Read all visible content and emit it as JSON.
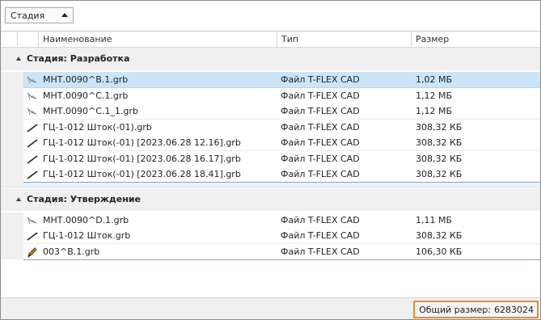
{
  "toolbar": {
    "group_by_label": "Стадия"
  },
  "columns": {
    "name": "Наименование",
    "type": "Тип",
    "size": "Размер"
  },
  "groups": [
    {
      "title": "Стадия: Разработка",
      "rows": [
        {
          "name": "МНТ.0090^В.1.grb",
          "type": "Файл T-FLEX CAD",
          "size": "1,02 МБ",
          "icon": "drawing-icon",
          "selected": true
        },
        {
          "name": "МНТ.0090^С.1.grb",
          "type": "Файл T-FLEX CAD",
          "size": "1,12 МБ",
          "icon": "drawing-icon"
        },
        {
          "name": "МНТ.0090^С.1_1.grb",
          "type": "Файл T-FLEX CAD",
          "size": "1,12 МБ",
          "icon": "drawing-icon"
        },
        {
          "name": "ГЦ-1-012 Шток(-01).grb",
          "type": "Файл T-FLEX CAD",
          "size": "308,32 КБ",
          "icon": "line-icon"
        },
        {
          "name": "ГЦ-1-012 Шток(-01) [2023.06.28 12.16].grb",
          "type": "Файл T-FLEX CAD",
          "size": "308,32 КБ",
          "icon": "line-icon"
        },
        {
          "name": "ГЦ-1-012 Шток(-01) [2023.06.28 16.17].grb",
          "type": "Файл T-FLEX CAD",
          "size": "308,32 КБ",
          "icon": "line-icon"
        },
        {
          "name": "ГЦ-1-012 Шток(-01) [2023.06.28 18.41].grb",
          "type": "Файл T-FLEX CAD",
          "size": "308,32 КБ",
          "icon": "line-icon"
        }
      ]
    },
    {
      "title": "Стадия: Утверждение",
      "rows": [
        {
          "name": "МНТ.0090^D.1.grb",
          "type": "Файл T-FLEX CAD",
          "size": "1,11 МБ",
          "icon": "drawing-icon"
        },
        {
          "name": "ГЦ-1-012 Шток.grb",
          "type": "Файл T-FLEX CAD",
          "size": "308,32 КБ",
          "icon": "line-icon"
        },
        {
          "name": "003^В.1.grb",
          "type": "Файл T-FLEX CAD",
          "size": "106,30 КБ",
          "icon": "pencil-icon"
        }
      ]
    }
  ],
  "footer": {
    "total_label": "Общий размер:",
    "total_value": "6283024"
  },
  "colors": {
    "selection": "#cce4f7",
    "group_background": "#f0f0f0",
    "highlight_border": "#f08a1c"
  }
}
